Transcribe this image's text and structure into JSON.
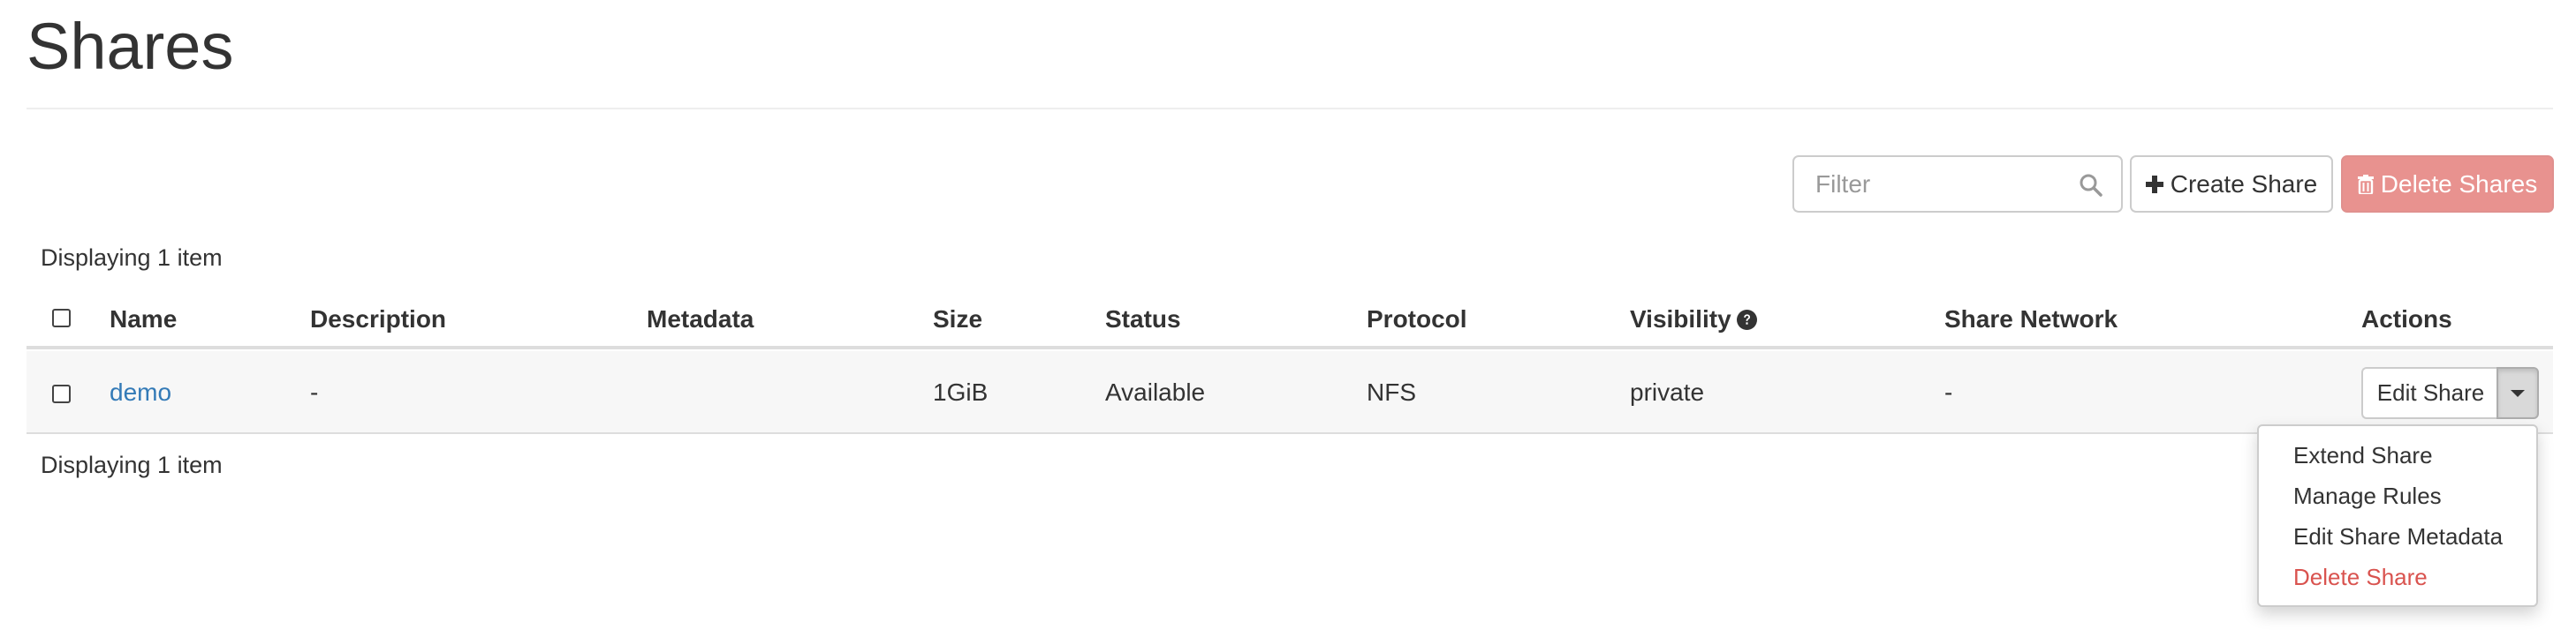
{
  "page": {
    "title": "Shares"
  },
  "toolbar": {
    "filter_placeholder": "Filter",
    "filter_value": "",
    "search_icon": "search-icon",
    "create_icon": "plus-icon",
    "create_label": "Create Share",
    "delete_icon": "trash-icon",
    "delete_label": "Delete Shares",
    "delete_color": "#e8928f"
  },
  "table": {
    "count_top": "Displaying 1 item",
    "count_bottom": "Displaying 1 item",
    "columns": [
      "Name",
      "Description",
      "Metadata",
      "Size",
      "Status",
      "Protocol",
      "Visibility",
      "Share Network",
      "Actions"
    ],
    "rows": [
      {
        "name": "demo",
        "description": "-",
        "metadata": "",
        "size": "1GiB",
        "status": "Available",
        "protocol": "NFS",
        "visibility": "private",
        "share_network": "-",
        "action_label": "Edit Share"
      }
    ]
  },
  "row_menu": {
    "items": [
      {
        "label": "Extend Share"
      },
      {
        "label": "Manage Rules"
      },
      {
        "label": "Edit Share Metadata"
      },
      {
        "label": "Delete Share",
        "color": "#d9534f"
      }
    ]
  },
  "colors": {
    "link": "#337ab7",
    "danger": "#d9534f"
  }
}
